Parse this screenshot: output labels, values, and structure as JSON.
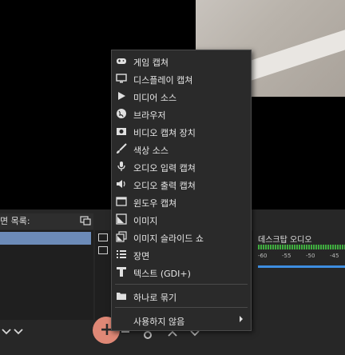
{
  "scenes_panel": {
    "title": "면 목록:"
  },
  "audio_mixer": {
    "device_name": "데스크탑 오디오",
    "ticks": [
      "-60",
      "-55",
      "-50",
      "-45",
      "-40"
    ]
  },
  "context_menu": {
    "items": [
      {
        "label": "게임 캡쳐",
        "icon": "gamepad-icon"
      },
      {
        "label": "디스플레이 캡쳐",
        "icon": "monitor-icon"
      },
      {
        "label": "미디어 소스",
        "icon": "play-icon"
      },
      {
        "label": "브라우저",
        "icon": "globe-icon"
      },
      {
        "label": "비디오 캡쳐 장치",
        "icon": "camera-icon"
      },
      {
        "label": "색상 소스",
        "icon": "brush-icon"
      },
      {
        "label": "오디오 입력 캡쳐",
        "icon": "microphone-icon"
      },
      {
        "label": "오디오 출력 캡쳐",
        "icon": "speaker-icon"
      },
      {
        "label": "윈도우 캡쳐",
        "icon": "window-icon"
      },
      {
        "label": "이미지",
        "icon": "image-icon"
      },
      {
        "label": "이미지 슬라이드 쇼",
        "icon": "slideshow-icon"
      },
      {
        "label": "장면",
        "icon": "list-icon"
      },
      {
        "label": "텍스트 (GDI+)",
        "icon": "text-icon"
      }
    ],
    "group_label": "하나로 묶기",
    "deprecated_label": "사용하지 않음"
  },
  "toolbar": {
    "add_label": "+"
  },
  "colors": {
    "highlight": "#e98d7a",
    "selection": "#6c8bb8",
    "meter_green": "#3fae3f",
    "volume_blue": "#3d8de0"
  }
}
